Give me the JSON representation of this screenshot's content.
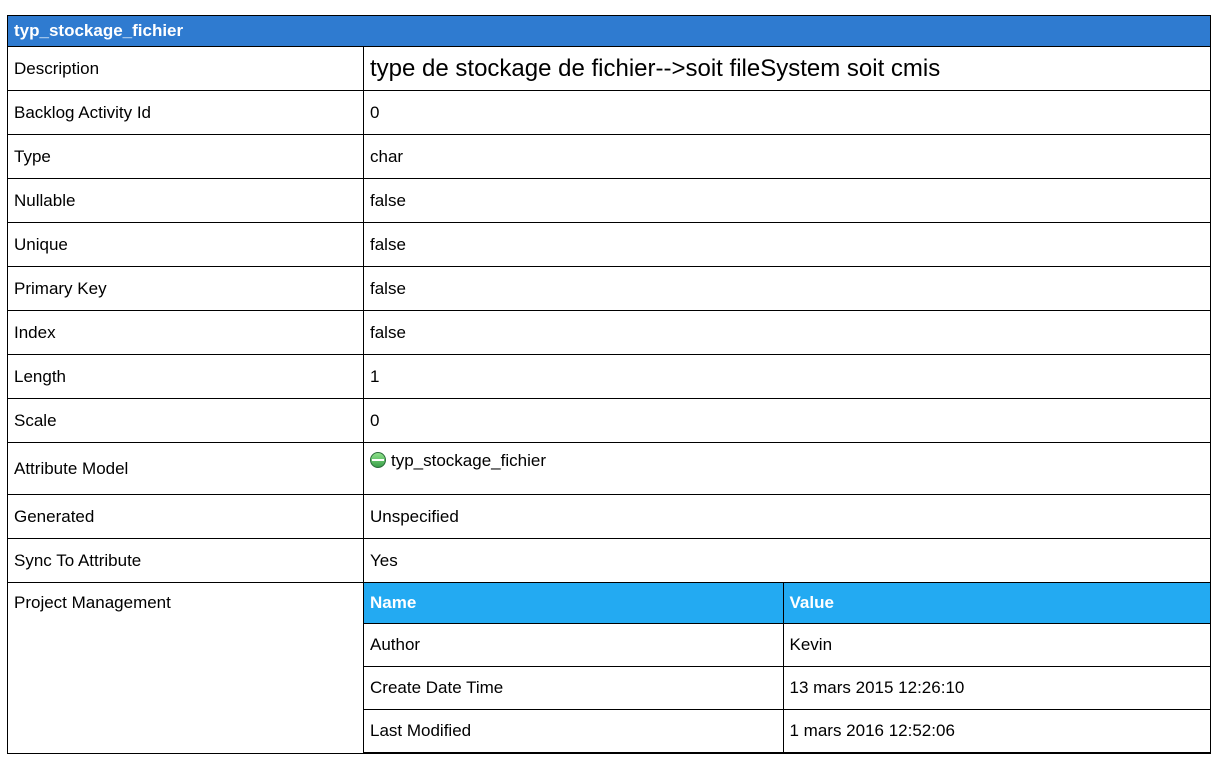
{
  "header": {
    "title": "typ_stockage_fichier"
  },
  "rows": [
    {
      "label": "Description",
      "value": "type de stockage de fichier-->soit fileSystem soit cmis"
    },
    {
      "label": "Backlog Activity Id",
      "value": "0"
    },
    {
      "label": "Type",
      "value": "char"
    },
    {
      "label": "Nullable",
      "value": "false"
    },
    {
      "label": "Unique",
      "value": "false"
    },
    {
      "label": "Primary Key",
      "value": "false"
    },
    {
      "label": "Index",
      "value": "false"
    },
    {
      "label": "Length",
      "value": "1"
    },
    {
      "label": "Scale",
      "value": "0"
    },
    {
      "label": "Attribute Model",
      "value": "typ_stockage_fichier",
      "icon": "attribute-model-icon"
    },
    {
      "label": "Generated",
      "value": "Unspecified"
    },
    {
      "label": "Sync To Attribute",
      "value": "Yes"
    }
  ],
  "project_management": {
    "label": "Project Management",
    "columns": [
      "Name",
      "Value"
    ],
    "rows": [
      {
        "name": "Author",
        "value": "Kevin"
      },
      {
        "name": "Create Date Time",
        "value": "13 mars 2015 12:26:10"
      },
      {
        "name": "Last Modified",
        "value": "1 mars 2016 12:52:06"
      }
    ]
  },
  "colors": {
    "header_bg": "#2f7bd0",
    "subheader_bg": "#23aaf2"
  }
}
